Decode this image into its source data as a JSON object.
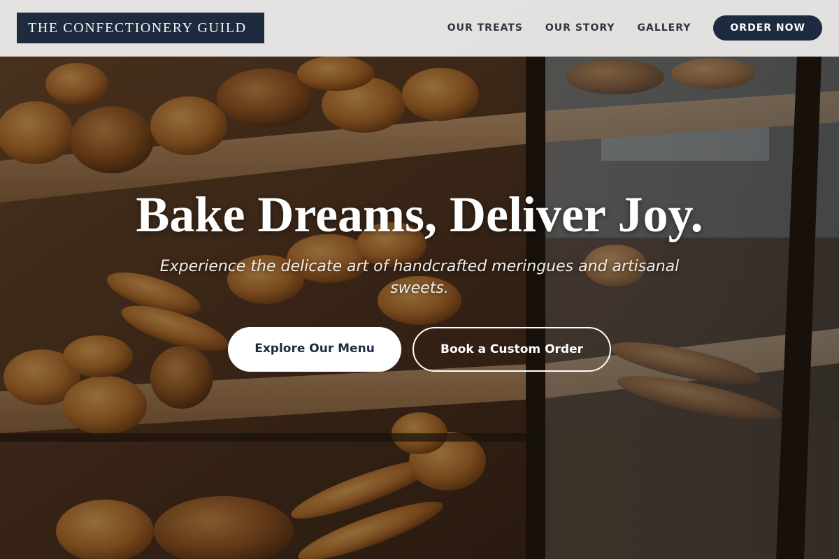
{
  "header": {
    "logo_text": "THE CONFECTIONERY GUILD",
    "nav": {
      "treats": "OUR TREATS",
      "story": "OUR STORY",
      "gallery": "GALLERY"
    },
    "cta_label": "ORDER NOW"
  },
  "hero": {
    "title": "Bake Dreams, Deliver Joy.",
    "subtitle": "Experience the delicate art of handcrafted meringues and artisanal sweets.",
    "primary_button": "Explore Our Menu",
    "secondary_button": "Book a Custom Order",
    "background": "bakery-display-case-photo"
  },
  "colors": {
    "navy": "#1e2a3e",
    "header_bg": "#f0f0f0",
    "white": "#ffffff"
  }
}
